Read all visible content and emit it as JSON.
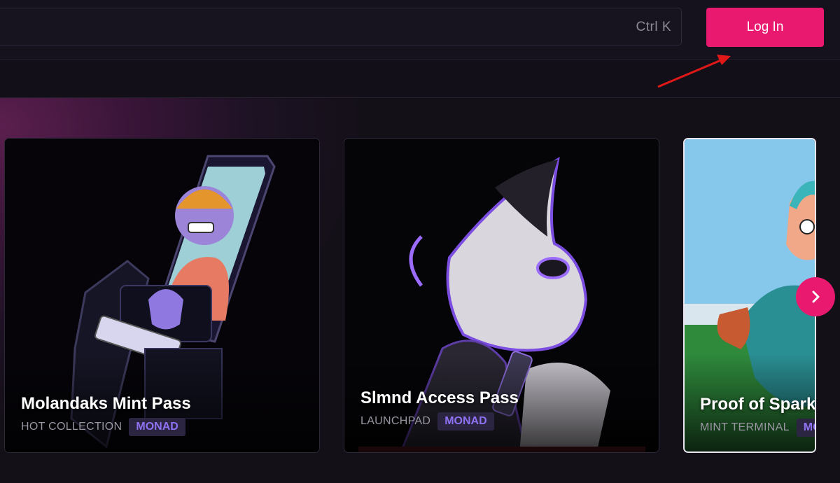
{
  "header": {
    "search": {
      "value": "",
      "shortcut": "Ctrl K"
    },
    "login_label": "Log In"
  },
  "carousel": {
    "cards": [
      {
        "title": "Molandaks Mint Pass",
        "category": "HOT COLLECTION",
        "chain": "MONAD"
      },
      {
        "title": "Slmnd Access Pass",
        "category": "LAUNCHPAD",
        "chain": "MONAD"
      },
      {
        "title": "Proof of Spark",
        "category": "MINT TERMINAL",
        "chain": "MONAD"
      }
    ]
  },
  "colors": {
    "accent": "#e8196f",
    "badge_text": "#8e72f2",
    "background": "#120f1a"
  },
  "icons": {
    "next": "chevron-right-icon"
  }
}
